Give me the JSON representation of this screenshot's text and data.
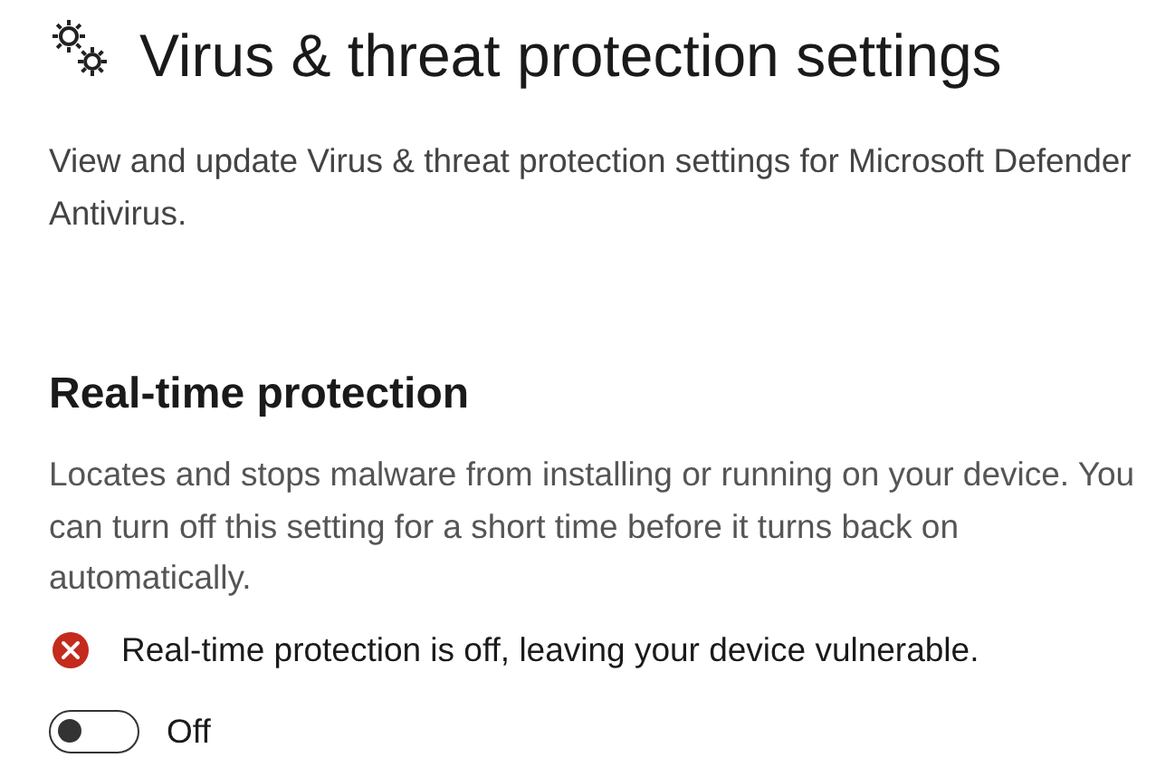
{
  "header": {
    "title": "Virus & threat protection settings",
    "description": "View and update Virus & threat protection settings for Microsoft Defender Antivirus."
  },
  "section": {
    "title": "Real-time protection",
    "description": "Locates and stops malware from installing or running on your device. You can turn off this setting for a short time before it turns back on automatically.",
    "alert": {
      "kind": "error",
      "text": "Real-time protection is off, leaving your device vulnerable."
    },
    "toggle": {
      "on": false,
      "label": "Off"
    }
  }
}
